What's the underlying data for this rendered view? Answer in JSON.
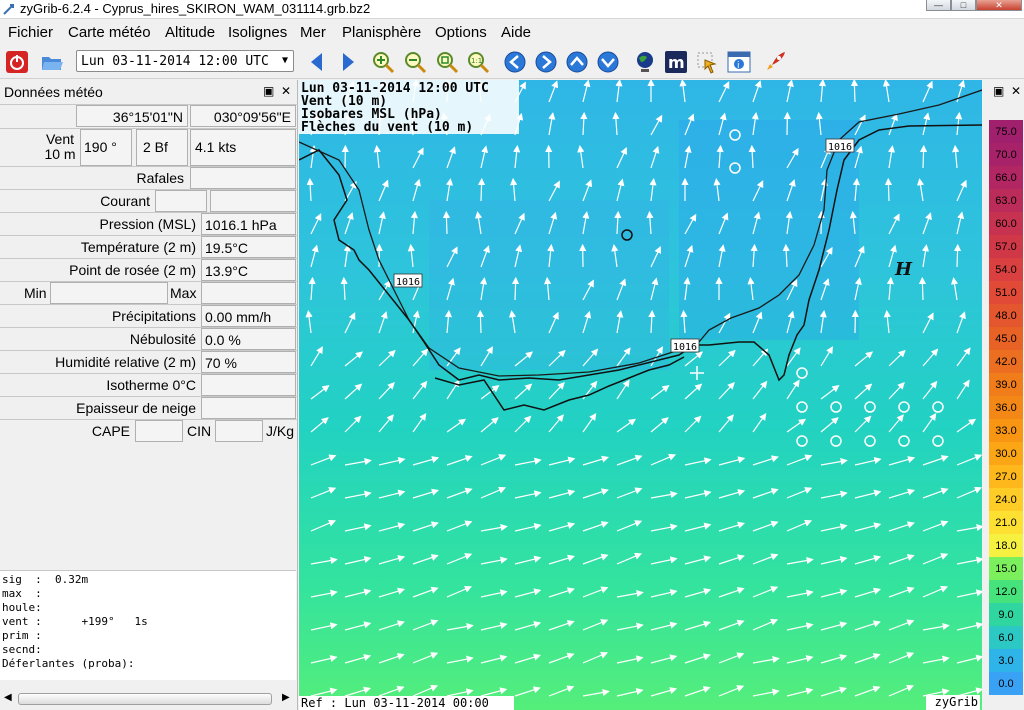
{
  "window": {
    "title": "zyGrib-6.2.4 - Cyprus_hires_SKIRON_WAM_031114.grb.bz2"
  },
  "menu": [
    "Fichier",
    "Carte météo",
    "Altitude",
    "Isolignes",
    "Mer",
    "Planisphère",
    "Options",
    "Aide"
  ],
  "toolbar": {
    "date_select": "Lun 03-11-2014 12:00 UTC",
    "zoom_fit_label": "1:1"
  },
  "panel": {
    "title": "Données météo",
    "lat": "36°15'01\"N",
    "lon": "030°09'56\"E",
    "wind_label_1": "Vent",
    "wind_label_2": "10 m",
    "wind_dir": "190 °",
    "wind_bf": "2 Bf",
    "wind_kts": "4.1  kts",
    "gusts_label": "Rafales",
    "current_label": "Courant",
    "pressure_label": "Pression (MSL)",
    "pressure": "1016.1 hPa",
    "temp_label": "Température (2 m)",
    "temp": "19.5°C",
    "dew_label": "Point de rosée (2 m)",
    "dew": "13.9°C",
    "min_label": "Min",
    "max_label": "Max",
    "precip_label": "Précipitations",
    "precip": "0.00 mm/h",
    "cloud_label": "Nébulosité",
    "cloud": "0.0 %",
    "humid_label": "Humidité relative (2 m)",
    "humid": "70 %",
    "iso0_label": "Isotherme 0°C",
    "snow_label": "Epaisseur de neige",
    "cape_label": "CAPE",
    "cin_label": "CIN",
    "cape_unit": "J/Kg",
    "wave_text": "sig  :  0.32m\nmax  :\nhoule:\nvent :      +199°   1s\nprim :\nsecnd:\nDéferlantes (proba):"
  },
  "map": {
    "date": "Lun 03-11-2014 12:00 UTC",
    "layer1": "Vent (10 m)",
    "layer2": "Isobares MSL (hPa)",
    "layer3": "Flèches du vent (10 m)",
    "isobar_value": "1016",
    "high_marker": "H",
    "ref": "Ref : Lun 03-11-2014 00:00 UTC",
    "brand": "zyGrib"
  },
  "legend": {
    "entries": [
      {
        "v": "75.0",
        "c": "#a0206e"
      },
      {
        "v": "70.0",
        "c": "#a8226a"
      },
      {
        "v": "66.0",
        "c": "#b22664"
      },
      {
        "v": "63.0",
        "c": "#bc2c5a"
      },
      {
        "v": "60.0",
        "c": "#c63250"
      },
      {
        "v": "57.0",
        "c": "#d03848"
      },
      {
        "v": "54.0",
        "c": "#da4040"
      },
      {
        "v": "51.0",
        "c": "#e04a36"
      },
      {
        "v": "48.0",
        "c": "#e4562e"
      },
      {
        "v": "45.0",
        "c": "#e86226"
      },
      {
        "v": "42.0",
        "c": "#ec6e20"
      },
      {
        "v": "39.0",
        "c": "#f07c1a"
      },
      {
        "v": "36.0",
        "c": "#f48816"
      },
      {
        "v": "33.0",
        "c": "#f89614"
      },
      {
        "v": "30.0",
        "c": "#fca616"
      },
      {
        "v": "27.0",
        "c": "#feb81c"
      },
      {
        "v": "24.0",
        "c": "#fecc26"
      },
      {
        "v": "21.0",
        "c": "#fee032"
      },
      {
        "v": "18.0",
        "c": "#f6f040"
      },
      {
        "v": "15.0",
        "c": "#7cf05c"
      },
      {
        "v": "12.0",
        "c": "#46e27c"
      },
      {
        "v": "9.0",
        "c": "#30d6a0"
      },
      {
        "v": "6.0",
        "c": "#2cc8c4"
      },
      {
        "v": "3.0",
        "c": "#2eb4e8"
      },
      {
        "v": "0.0",
        "c": "#3aa2f4"
      }
    ]
  }
}
